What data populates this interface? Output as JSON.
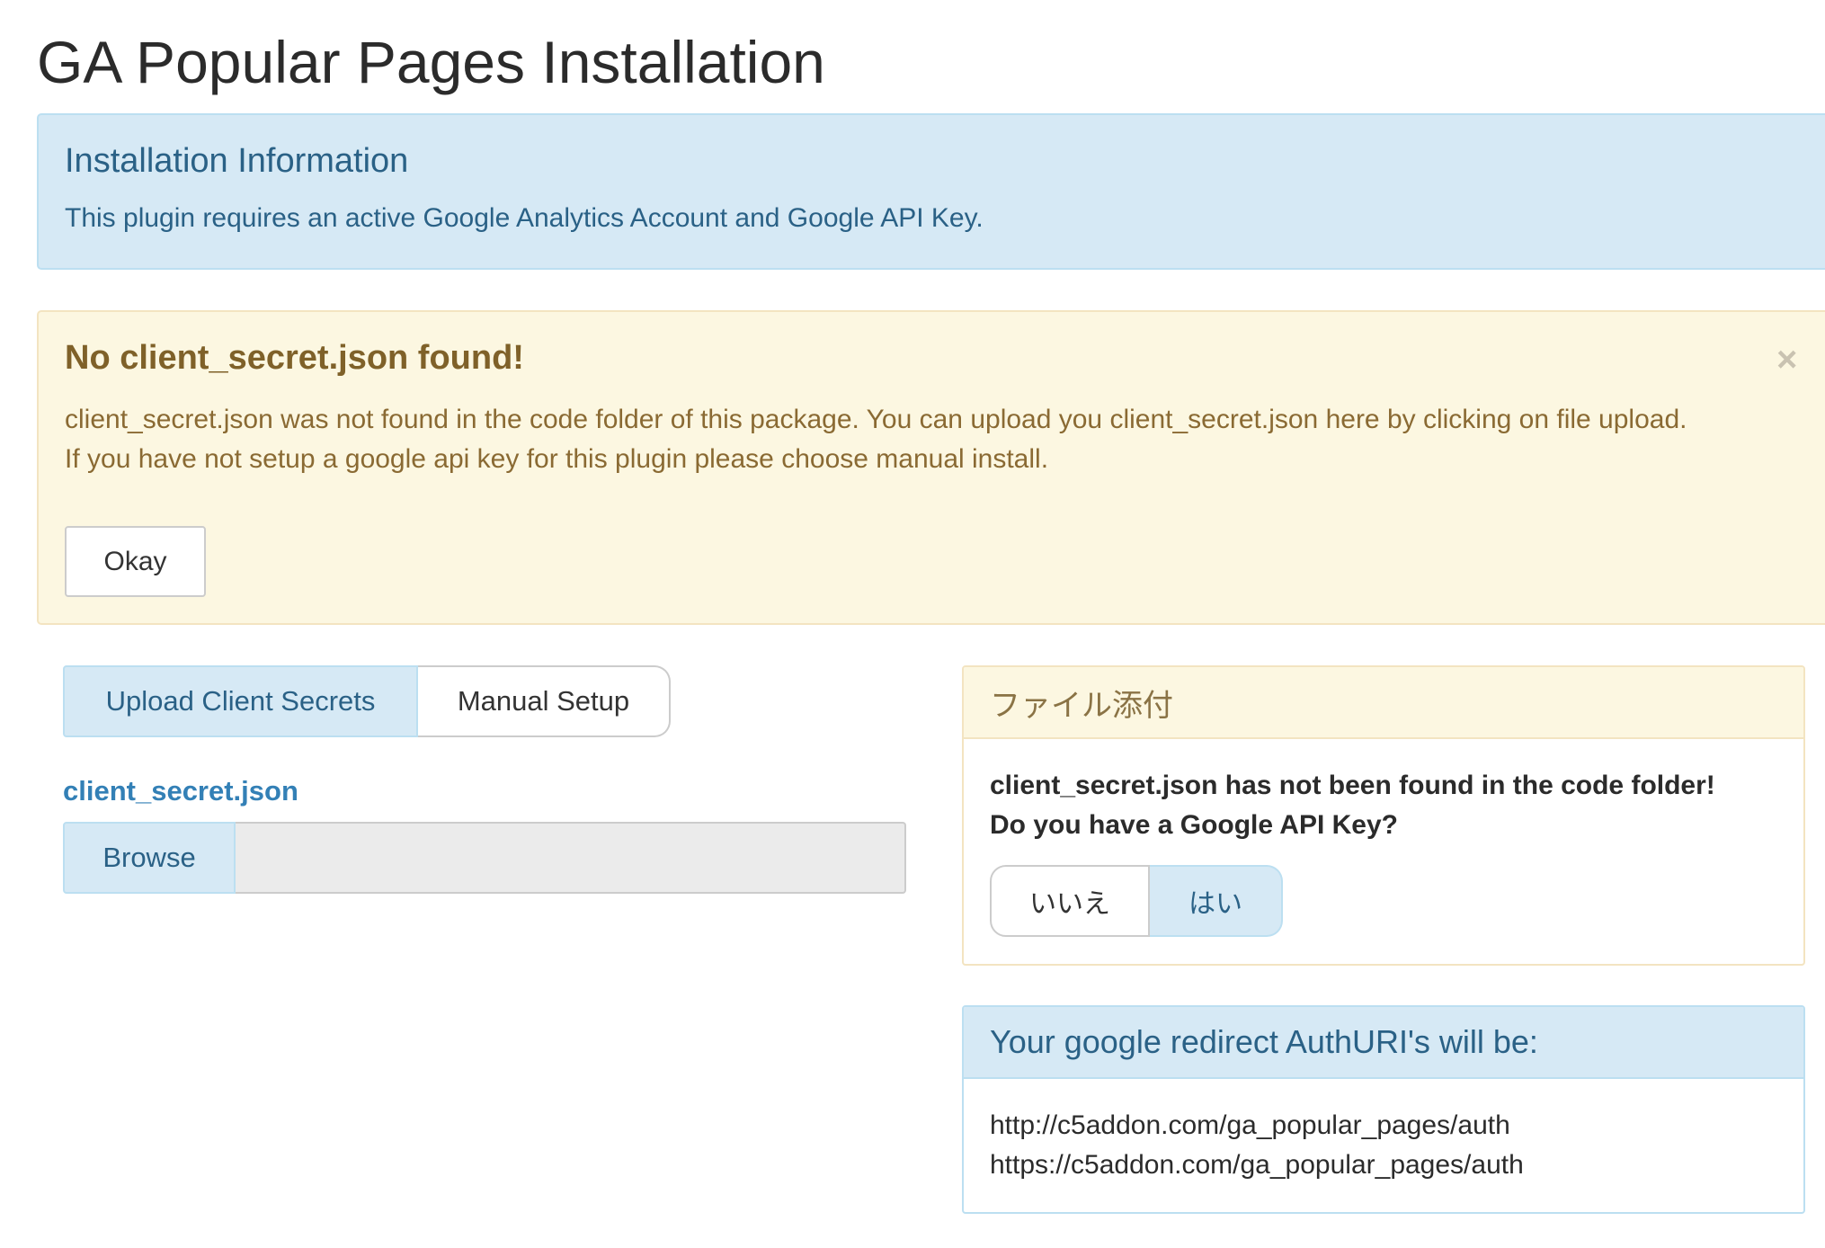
{
  "page": {
    "title": "GA Popular Pages Installation"
  },
  "info_alert": {
    "heading": "Installation Information",
    "text": "This plugin requires an active Google Analytics Account and Google API Key."
  },
  "warning_alert": {
    "heading": "No client_secret.json found!",
    "close_icon": "×",
    "line1": "client_secret.json was not found in the code folder of this package. You can upload you client_secret.json here by clicking on file upload.",
    "line2": "If you have not setup a google api key for this plugin please choose manual install.",
    "okay_label": "Okay"
  },
  "tabs": [
    {
      "label": "Upload Client Secrets",
      "active": true
    },
    {
      "label": "Manual Setup",
      "active": false
    }
  ],
  "upload": {
    "field_label": "client_secret.json",
    "browse_label": "Browse",
    "file_value": ""
  },
  "file_panel": {
    "heading": "ファイル添付",
    "question_line1": "client_secret.json has not been found in the code folder!",
    "question_line2": "Do you have a Google API Key?",
    "no_label": "いいえ",
    "yes_label": "はい",
    "selected": "はい"
  },
  "redirect_panel": {
    "heading": "Your google redirect AuthURI's will be:",
    "uris": [
      "http://c5addon.com/ga_popular_pages/auth",
      "https://c5addon.com/ga_popular_pages/auth"
    ]
  },
  "colors": {
    "info_bg": "#d6e9f5",
    "info_text": "#2a6186",
    "warning_bg": "#fcf7e1",
    "warning_text": "#8a6a33",
    "link_blue": "#3380b6"
  }
}
